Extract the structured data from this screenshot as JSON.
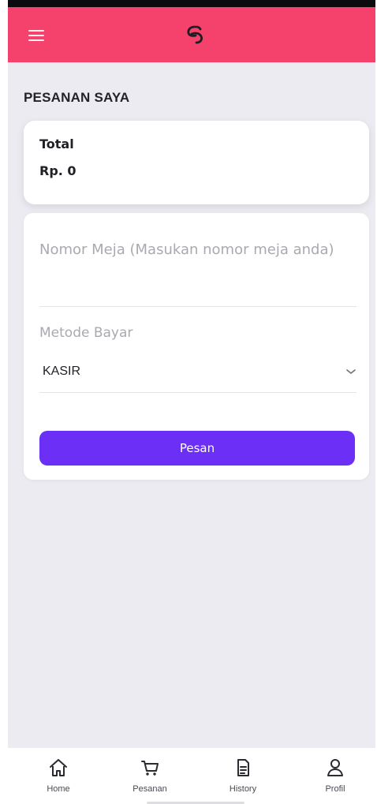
{
  "colors": {
    "topbar": "#f4426d",
    "background": "#ecebf1",
    "card": "#ffffff",
    "primary_button": "#6b2ff5"
  },
  "topbar": {
    "menu_icon": "hamburger-menu-icon",
    "logo_icon": "brand-logo-icon"
  },
  "page": {
    "title": "PESANAN SAYA"
  },
  "summary": {
    "total_label": "Total",
    "total_value": "Rp. 0"
  },
  "order_form": {
    "table_placeholder": "Nomor Meja (Masukan nomor meja anda)",
    "table_value": "",
    "payment_label": "Metode Bayar",
    "payment_value": "KASIR",
    "submit_label": "Pesan"
  },
  "bottom_nav": {
    "items": [
      {
        "label": "Home",
        "icon": "home-icon"
      },
      {
        "label": "Pesanan",
        "icon": "cart-icon"
      },
      {
        "label": "History",
        "icon": "document-icon"
      },
      {
        "label": "Profil",
        "icon": "user-icon"
      }
    ]
  }
}
